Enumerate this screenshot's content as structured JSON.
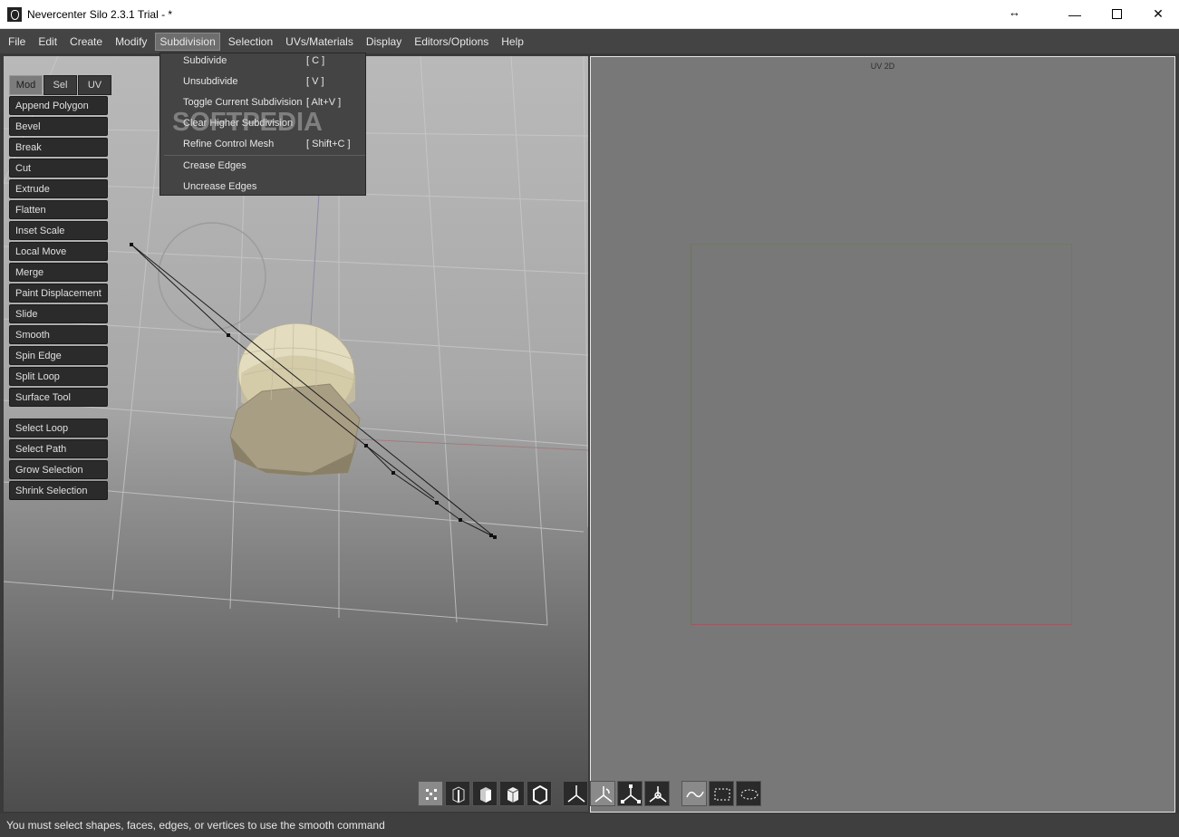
{
  "window": {
    "title": "Nevercenter Silo 2.3.1 Trial - *",
    "controls": {
      "minimize": "—",
      "maximize": "",
      "close": "✕",
      "resize_glyph": "↔"
    }
  },
  "menubar": {
    "items": [
      "File",
      "Edit",
      "Create",
      "Modify",
      "Subdivision",
      "Selection",
      "UVs/Materials",
      "Display",
      "Editors/Options",
      "Help"
    ],
    "active": "Subdivision"
  },
  "dropdown": {
    "items": [
      {
        "label": "Subdivide",
        "shortcut": "[ C ]"
      },
      {
        "label": "Unsubdivide",
        "shortcut": "[ V ]"
      },
      {
        "label": "Toggle Current Subdivision",
        "shortcut": "[ Alt+V ]"
      },
      {
        "label": "Clear Higher Subdivision",
        "shortcut": ""
      },
      {
        "label": "Refine Control Mesh",
        "shortcut": "[ Shift+C ]"
      },
      {
        "label": "Crease Edges",
        "shortcut": ""
      },
      {
        "label": "Uncrease Edges",
        "shortcut": ""
      }
    ]
  },
  "watermark": "SOFTPEDIA",
  "tool_panel": {
    "tabs": [
      "Mod",
      "Sel",
      "UV"
    ],
    "active_tab": "Mod",
    "modify_tools": [
      "Append Polygon",
      "Bevel",
      "Break",
      "Cut",
      "Extrude",
      "Flatten",
      "Inset Scale",
      "Local Move",
      "Merge",
      "Paint Displacement",
      "Slide",
      "Smooth",
      "Spin Edge",
      "Split Loop",
      "Surface Tool"
    ],
    "selection_tools": [
      "Select Loop",
      "Select Path",
      "Grow Selection",
      "Shrink Selection"
    ]
  },
  "uv_view": {
    "title": "UV 2D"
  },
  "bottom_toolbar": {
    "buttons": [
      "vertex-mode-icon",
      "edge-mode-icon",
      "face-mode-icon",
      "object-mode-icon",
      "wireframe-object-icon",
      "move-manipulator-icon",
      "rotate-manipulator-icon",
      "scale-manipulator-icon",
      "universal-manipulator-icon",
      "lasso-curve-icon",
      "rect-select-icon",
      "ellipse-select-icon"
    ]
  },
  "status": {
    "message": "You must select shapes, faces, edges, or vertices to use the smooth command"
  },
  "colors": {
    "menubar": "#444444",
    "uv_bg": "#787878",
    "mesh": "#cfc5a5",
    "accent": "#6e6e6e"
  }
}
